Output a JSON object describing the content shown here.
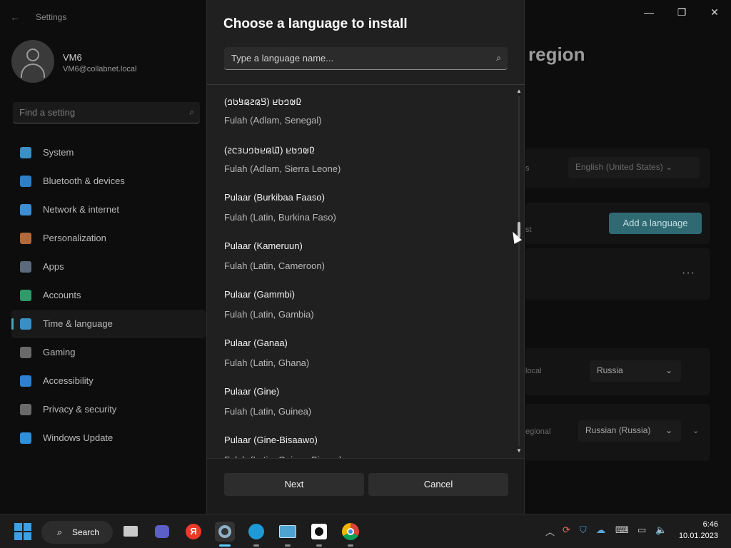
{
  "settings": {
    "title": "Settings",
    "user": {
      "name": "VM6",
      "email": "VM6@collabnet.local"
    },
    "find_placeholder": "Find a setting",
    "nav": [
      {
        "label": "System",
        "icon": "system-icon",
        "color": "#3a8fc4",
        "active": false
      },
      {
        "label": "Bluetooth & devices",
        "icon": "bluetooth-icon",
        "color": "#2f7fc7",
        "active": false
      },
      {
        "label": "Network & internet",
        "icon": "network-icon",
        "color": "#3f8ed2",
        "active": false
      },
      {
        "label": "Personalization",
        "icon": "brush-icon",
        "color": "#b26a3a",
        "active": false
      },
      {
        "label": "Apps",
        "icon": "apps-icon",
        "color": "#5a6a7a",
        "active": false
      },
      {
        "label": "Accounts",
        "icon": "accounts-icon",
        "color": "#2f9a6a",
        "active": false
      },
      {
        "label": "Time & language",
        "icon": "globe-clock-icon",
        "color": "#3a8fc4",
        "active": true
      },
      {
        "label": "Gaming",
        "icon": "gaming-icon",
        "color": "#6a6a6a",
        "active": false
      },
      {
        "label": "Accessibility",
        "icon": "accessibility-icon",
        "color": "#2f80d0",
        "active": false
      },
      {
        "label": "Privacy & security",
        "icon": "shield-icon",
        "color": "#6a6a6a",
        "active": false
      },
      {
        "label": "Windows Update",
        "icon": "update-icon",
        "color": "#2f8fd8",
        "active": false
      }
    ],
    "right": {
      "title_fragment": "region",
      "row1_label_fragment": "s",
      "row1_value": "English (United States)",
      "row2_label_fragment": "st",
      "add_language": "Add a language",
      "more": "···",
      "row4_label_fragment": "local",
      "row4_value": "Russia",
      "row5_label_fragment": "egional",
      "row5_value": "Russian (Russia)"
    }
  },
  "dialog": {
    "title": "Choose a language to install",
    "search_placeholder": "Type a language name...",
    "languages": [
      {
        "native": "(𞤘𞤫𞤲𞤫𞤺𞤢𞤤) 𞤆𞤵𞤤𞤢𞤪",
        "english": "Fulah (Adlam, Senegal)"
      },
      {
        "native": "(𞤅𞤫𞤪𞤢𞤤𞤭𞤴𞤮𞤲) 𞤆𞤵𞤤𞤢𞤪",
        "english": "Fulah (Adlam, Sierra Leone)"
      },
      {
        "native": "Pulaar (Burkibaa Faaso)",
        "english": "Fulah (Latin, Burkina Faso)"
      },
      {
        "native": "Pulaar (Kameruun)",
        "english": "Fulah (Latin, Cameroon)"
      },
      {
        "native": "Pulaar (Gammbi)",
        "english": "Fulah (Latin, Gambia)"
      },
      {
        "native": "Pulaar (Ganaa)",
        "english": "Fulah (Latin, Ghana)"
      },
      {
        "native": "Pulaar (Gine)",
        "english": "Fulah (Latin, Guinea)"
      },
      {
        "native": "Pulaar (Gine-Bisaawo)",
        "english": "Fulah (Latin, Guinea-Bissau)"
      }
    ],
    "next_label": "Next",
    "cancel_label": "Cancel"
  },
  "taskbar": {
    "search_label": "Search",
    "apps": [
      "file-explorer-icon",
      "teams-icon",
      "yandex-icon",
      "settings-icon",
      "edge-icon",
      "control-panel-icon",
      "kaspersky-icon",
      "chrome-icon"
    ],
    "time": "6:46",
    "date": "10.01.2023"
  }
}
